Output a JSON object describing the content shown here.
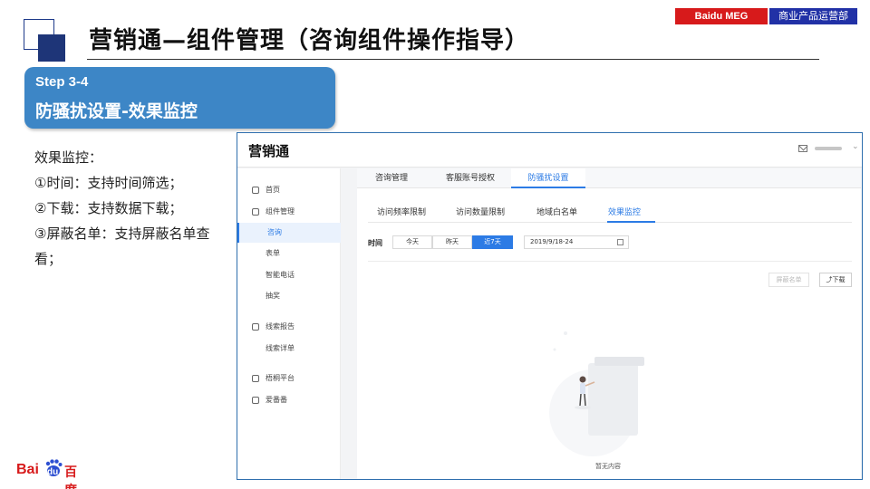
{
  "header": {
    "title": "营销通—组件管理（咨询组件操作指导）",
    "tag_left": "Baidu MEG",
    "tag_right": "商业产品运营部"
  },
  "step": {
    "number": "Step 3-4",
    "name": "防骚扰设置-效果监控"
  },
  "bullets": [
    "效果监控：",
    "①时间：支持时间筛选；",
    "②下载：支持数据下载；",
    "③屏蔽名单：支持屏蔽名单查看；"
  ],
  "logo": {
    "bai": "Bai",
    "du": "du",
    "cn": "百度"
  },
  "app": {
    "brand": "营销通",
    "sidebar": [
      {
        "label": "首页",
        "icon": "home-icon",
        "active": false
      },
      {
        "label": "组件管理",
        "icon": "component-icon",
        "active": false
      },
      {
        "label": "咨询",
        "icon": "",
        "active": true
      },
      {
        "label": "表单",
        "icon": "",
        "active": false
      },
      {
        "label": "智能电话",
        "icon": "",
        "active": false
      },
      {
        "label": "抽奖",
        "icon": "",
        "active": false
      },
      {
        "label": "线索报告",
        "icon": "chart-icon",
        "active": false
      },
      {
        "label": "线索详单",
        "icon": "",
        "active": false
      },
      {
        "label": "梧桐平台",
        "icon": "platform-icon",
        "active": false
      },
      {
        "label": "爱番番",
        "icon": "aifanfan-icon",
        "active": false
      }
    ],
    "tabs": [
      "咨询管理",
      "客服账号授权",
      "防骚扰设置"
    ],
    "subtabs": [
      "访问频率限制",
      "访问数量限制",
      "地域白名单",
      "效果监控"
    ],
    "time_label": "时间",
    "time_options": [
      "今天",
      "昨天",
      "近7天"
    ],
    "date_range": "2019/9/18-24",
    "mask_button": "屏蔽名单",
    "download_button": "下载",
    "empty_text": "暂无内容",
    "accent": "#2c7be5"
  }
}
